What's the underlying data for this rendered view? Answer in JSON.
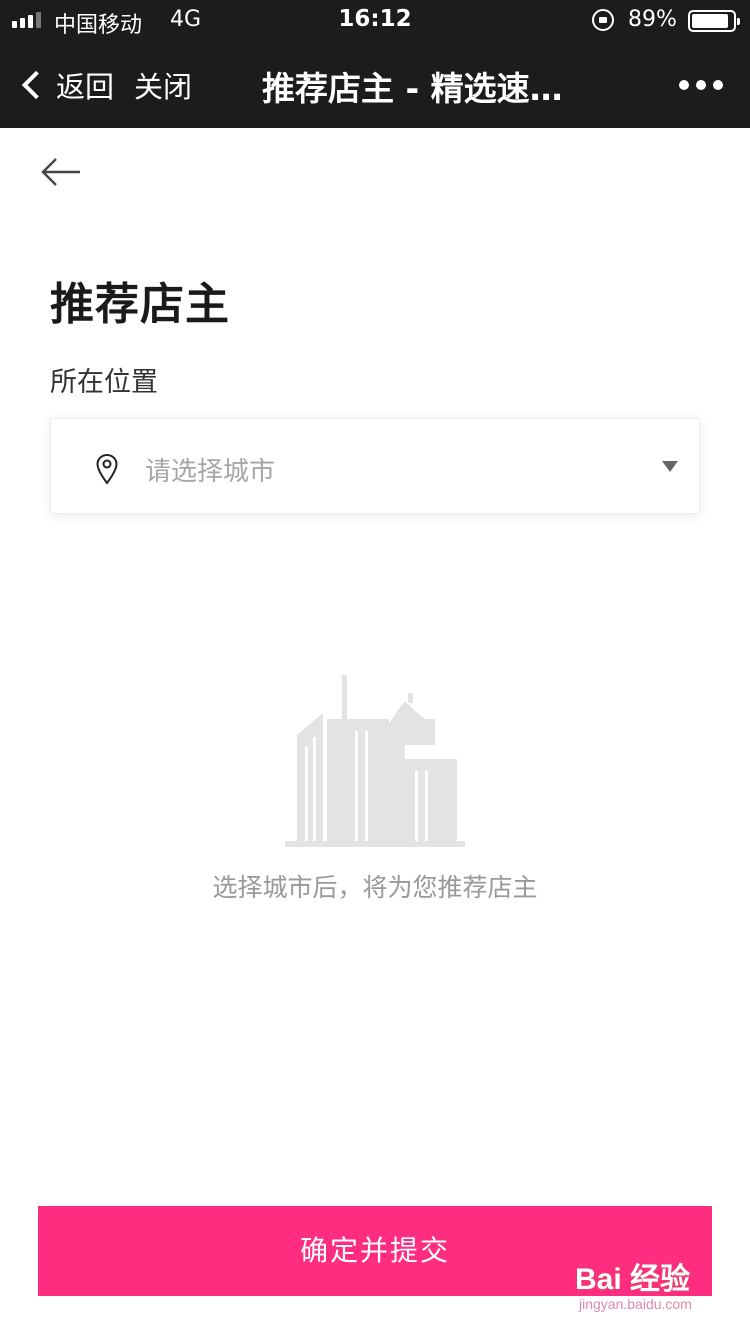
{
  "status_bar": {
    "carrier": "中国移动",
    "network": "4G",
    "time": "16:12",
    "battery": "89%",
    "battery_level": 0.89
  },
  "nav": {
    "back_label": "返回",
    "close_label": "关闭",
    "title": "推荐店主 - 精选速…"
  },
  "page": {
    "title": "推荐店主",
    "location_label": "所在位置",
    "city_placeholder": "请选择城市",
    "empty_hint": "选择城市后，将为您推荐店主",
    "submit_label": "确定并提交"
  },
  "watermark": {
    "logo": "Bai 经验",
    "url": "jingyan.baidu.com"
  },
  "colors": {
    "nav_bg": "#1c1c1e",
    "accent": "#ff2d7f",
    "placeholder": "#a6a6a6"
  }
}
